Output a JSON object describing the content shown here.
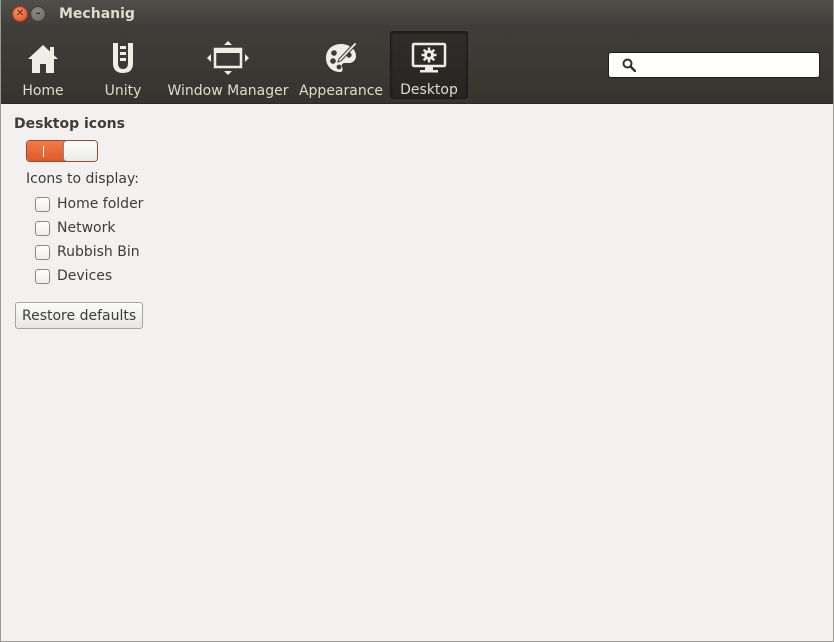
{
  "window": {
    "title": "Mechanig"
  },
  "toolbar": {
    "items": [
      {
        "label": "Home",
        "icon": "home-icon",
        "active": false
      },
      {
        "label": "Unity",
        "icon": "unity-icon",
        "active": false
      },
      {
        "label": "Window Manager",
        "icon": "window-manager-icon",
        "active": false
      },
      {
        "label": "Appearance",
        "icon": "appearance-icon",
        "active": false
      },
      {
        "label": "Desktop",
        "icon": "desktop-icon",
        "active": true
      }
    ],
    "search": {
      "value": "",
      "placeholder": ""
    }
  },
  "desktop": {
    "section_title": "Desktop icons",
    "toggle_on": true,
    "icons_label": "Icons to display:",
    "options": [
      {
        "label": "Home folder",
        "checked": false
      },
      {
        "label": "Network",
        "checked": false
      },
      {
        "label": "Rubbish Bin",
        "checked": false
      },
      {
        "label": "Devices",
        "checked": false
      }
    ],
    "restore_label": "Restore defaults"
  },
  "colors": {
    "accent": "#e9652f",
    "toolbar": "#3c3b37",
    "background": "#f2f1f0"
  }
}
